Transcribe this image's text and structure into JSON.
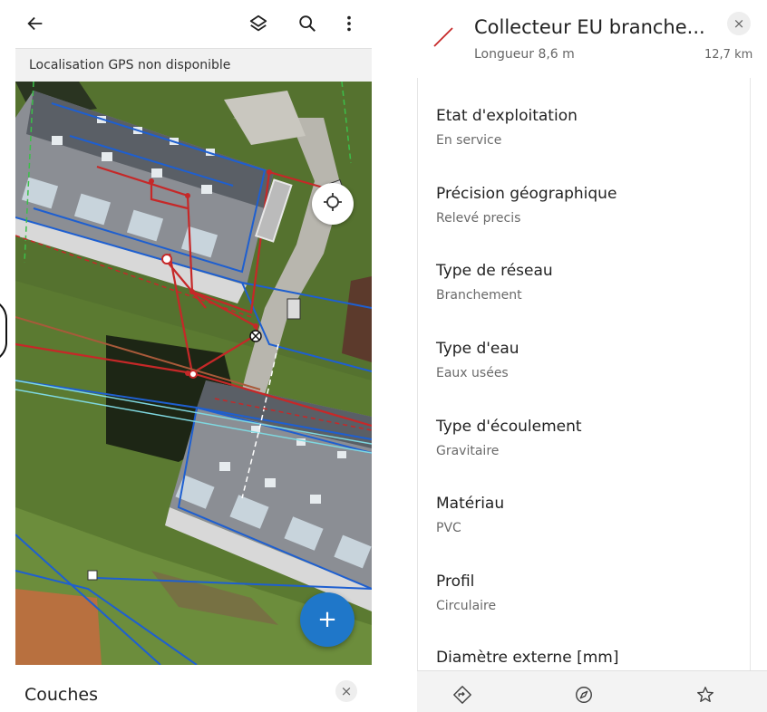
{
  "map_screen": {
    "toolbar": {
      "back_icon": "arrow-left-icon",
      "layers_icon": "layers-icon",
      "search_icon": "search-icon",
      "menu_icon": "more-vert-icon"
    },
    "gps_status": "Localisation GPS non disponible",
    "locate_icon": "crosshair-icon",
    "fab_label": "+",
    "layers_panel": {
      "title": "Couches",
      "close_label": "×"
    }
  },
  "feature": {
    "title": "Collecteur EU branche...",
    "subtitle": "Longueur 8,6 m",
    "distance": "12,7 km",
    "close_label": "×",
    "accent_color": "#c62828",
    "attributes": [
      {
        "label": "Etat d'exploitation",
        "value": "En service"
      },
      {
        "label": "Précision géographique",
        "value": "Relevé precis"
      },
      {
        "label": "Type de réseau",
        "value": "Branchement"
      },
      {
        "label": "Type d'eau",
        "value": "Eaux usées"
      },
      {
        "label": "Type d'écoulement",
        "value": "Gravitaire"
      },
      {
        "label": "Matériau",
        "value": "PVC"
      },
      {
        "label": "Profil",
        "value": "Circulaire"
      },
      {
        "label": "Diamètre externe [mm]",
        "value": ""
      }
    ],
    "actions": {
      "navigate_icon": "directions-icon",
      "compass_icon": "compass-icon",
      "favorite_icon": "star-icon"
    }
  },
  "colors": {
    "network_red": "#c62828",
    "network_blue": "#1e5fd0",
    "fab_blue": "#1f77c9"
  }
}
